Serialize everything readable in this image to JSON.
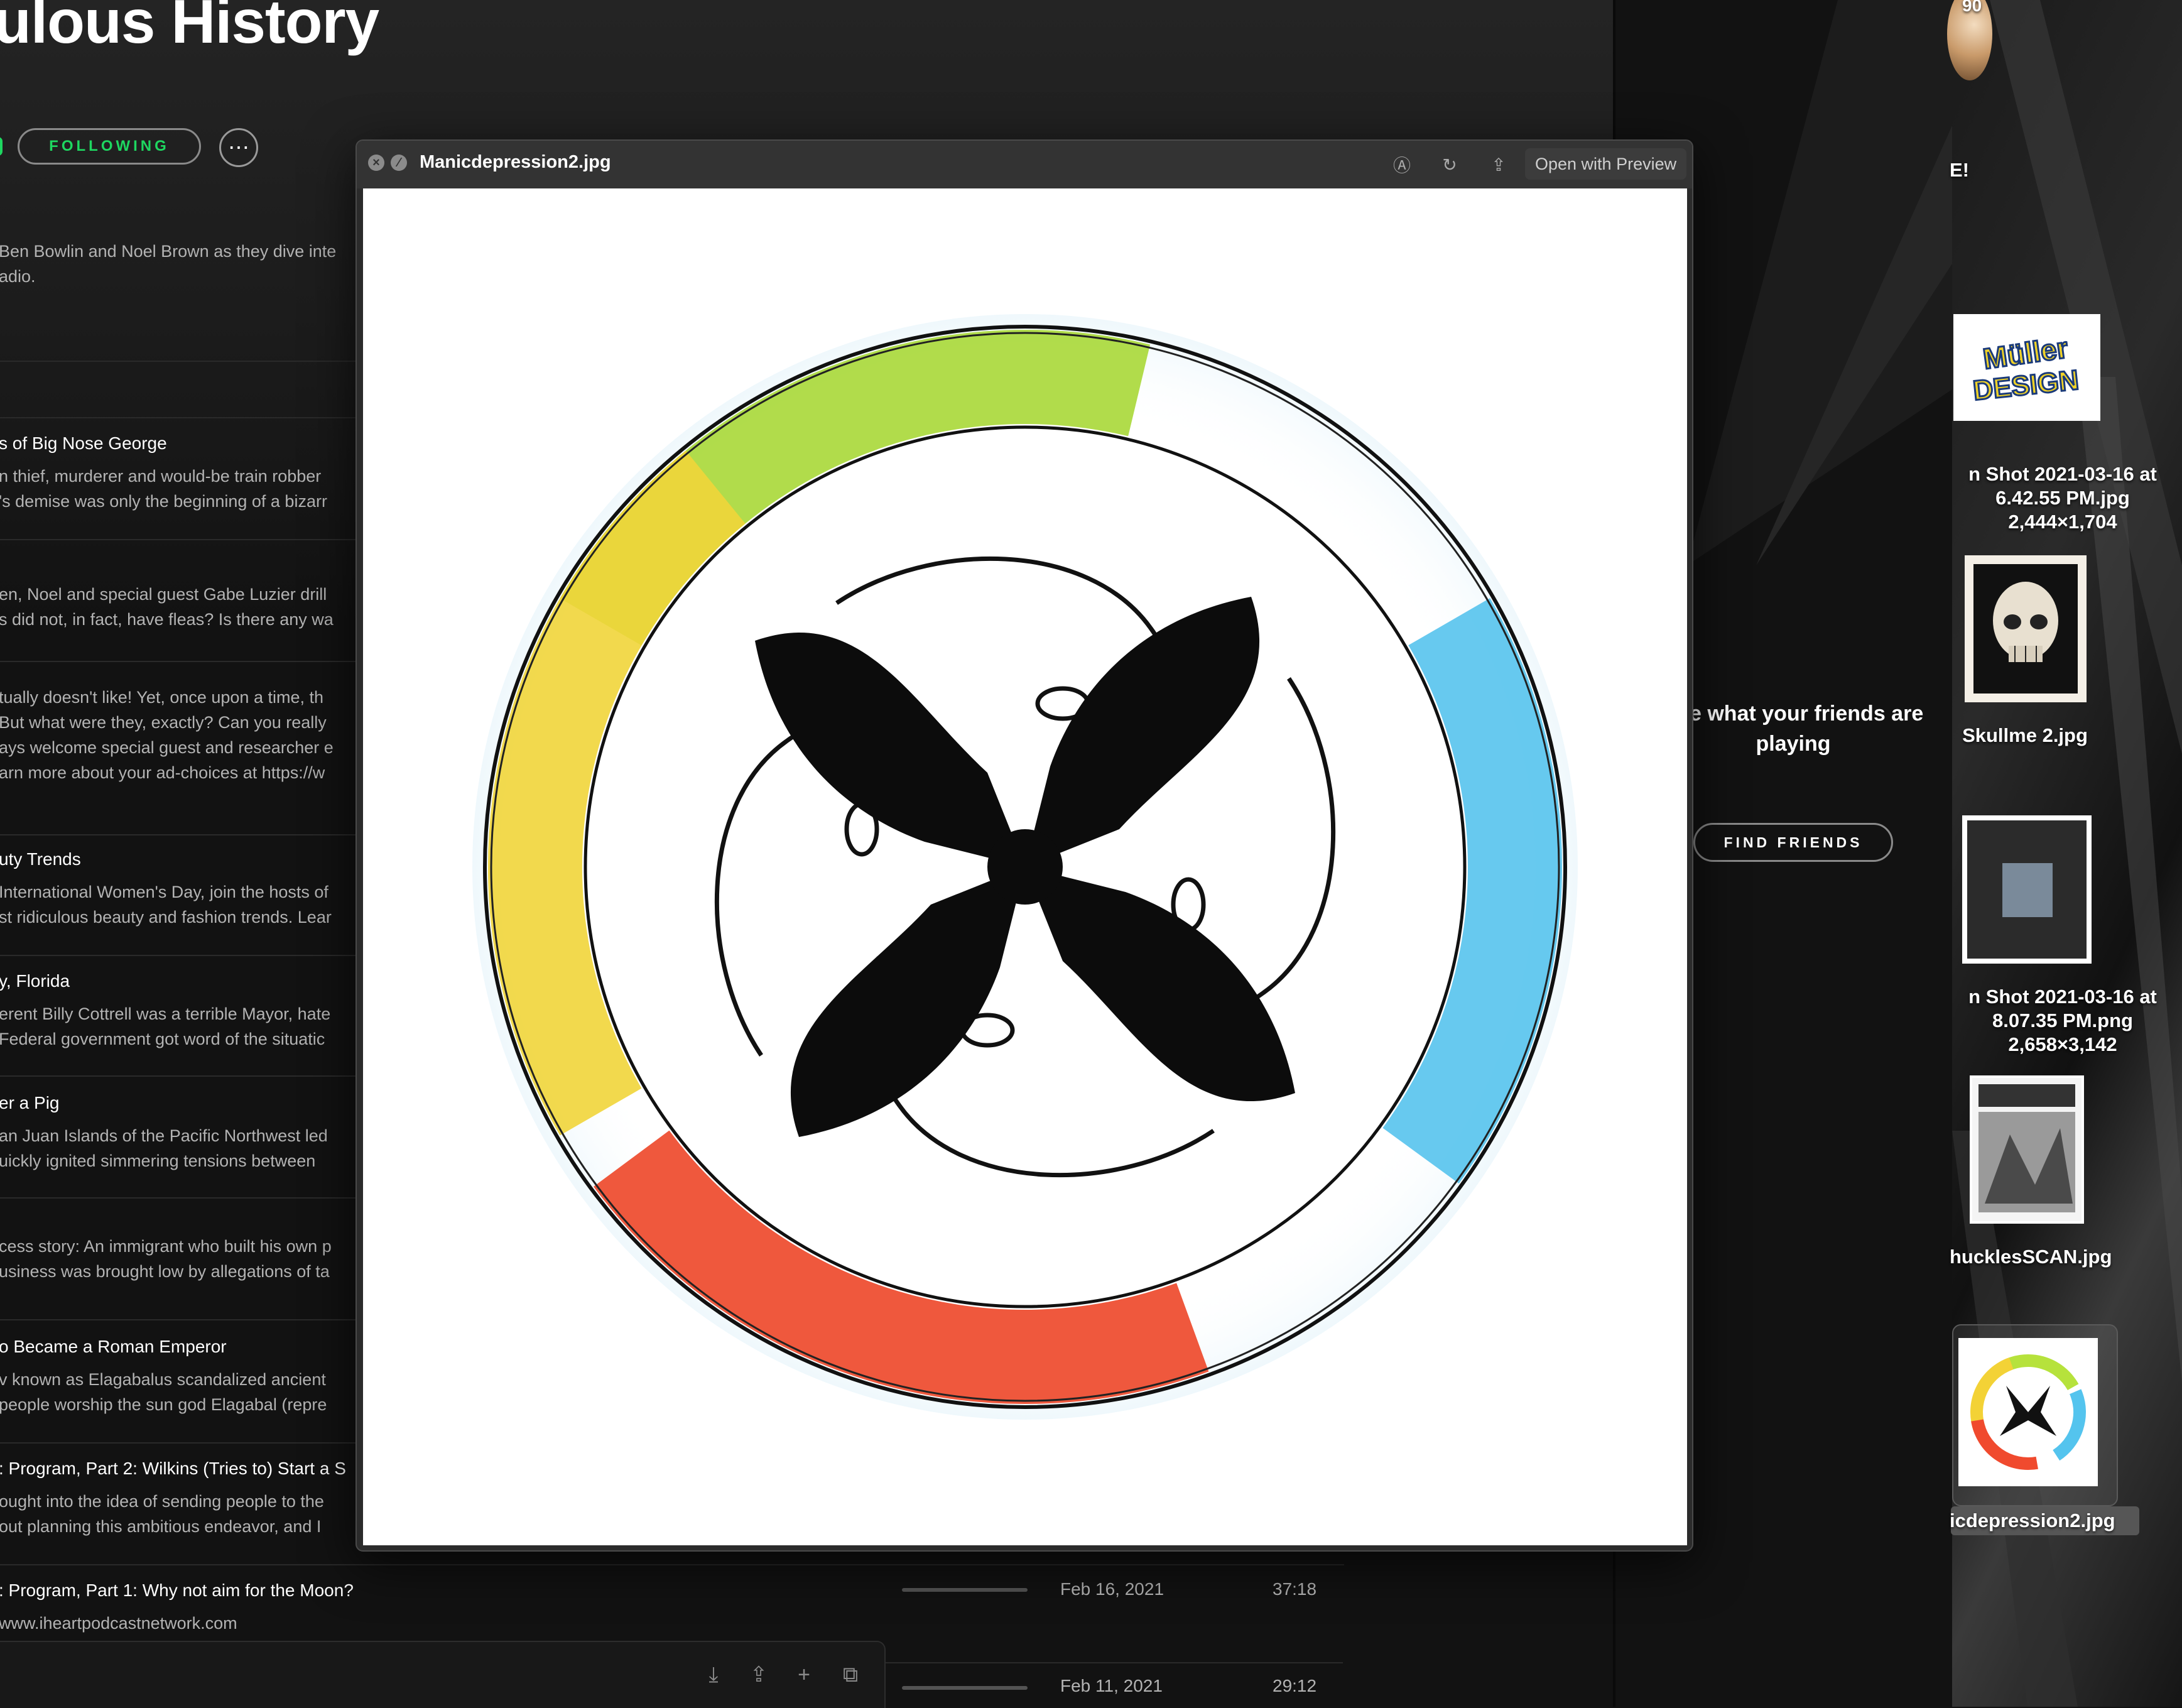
{
  "podcast": {
    "title": "ulous History",
    "follow_label": "FOLLOWING",
    "more_label": "⋯",
    "description": "Ben Bowlin and Noel Brown as they dive inte\nadio."
  },
  "episodes": [
    {
      "title": "s of Big Nose George",
      "desc": "n thief, murderer and would-be train robber\n's demise was only the beginning of a bizarr"
    },
    {
      "title": "",
      "desc": "en, Noel and special guest Gabe Luzier drill\ns did not, in fact, have fleas? Is there any wa"
    },
    {
      "title": "",
      "desc": "tually doesn't like! Yet, once upon a time, th\nBut what were they, exactly? Can you really\nays welcome special guest and researcher e\narn more about your ad-choices at https://w"
    },
    {
      "title": "uty Trends",
      "desc": "International Women's Day, join the hosts of\nst ridiculous beauty and fashion trends. Lear"
    },
    {
      "title": "y, Florida",
      "desc": "erent Billy Cottrell was a terrible Mayor, hate\nFederal government got word of the situatic"
    },
    {
      "title": "er a Pig",
      "desc": "an Juan Islands of the Pacific Northwest led\nuickly ignited simmering tensions between "
    },
    {
      "title": "",
      "desc": "cess story: An immigrant who built his own p\nusiness was brought low by allegations of ta"
    },
    {
      "title": "o Became a Roman Emperor",
      "desc": "v known as Elagabalus scandalized ancient\npeople worship the sun god Elagabal (repre"
    },
    {
      "title": ": Program, Part 2: Wilkins (Tries to) Start a S",
      "desc": "ought into the idea of sending people to the\nout planning this ambitious endeavor, and I"
    },
    {
      "title": ": Program, Part 1: Why not aim for the Moon?",
      "desc": "www.iheartpodcastnetwork.com"
    }
  ],
  "episode_meta": [
    {
      "date": "Feb 16, 2021",
      "duration": "37:18"
    },
    {
      "date": "Feb 11, 2021",
      "duration": "29:12"
    }
  ],
  "friends": {
    "text": "e what your friends are\nplaying",
    "button": "FIND FRIENDS"
  },
  "quicklook": {
    "filename": "Manicdepression2.jpg",
    "open_with": "Open with Preview",
    "close_glyph": "×",
    "fullscreen_glyph": "⁄"
  },
  "desktop": {
    "top_label": "90",
    "banner_label": "E!",
    "files": [
      {
        "label": "n Shot 2021-03-16 at\n6.42.55 PM.jpg\n2,444×1,704"
      },
      {
        "label": "Skullme 2.jpg"
      },
      {
        "label": "n Shot 2021-03-16 at\n8.07.35 PM.png\n2,658×3,142"
      },
      {
        "label": "hucklesSCAN.jpg"
      },
      {
        "label": "icdepression2.jpg"
      }
    ],
    "muller_logo_text": "Müller DESIGN"
  },
  "colors": {
    "spotify_green": "#1ed760",
    "background": "#121212",
    "window": "#2b2b2b"
  },
  "icons": {
    "download": "⤓",
    "share": "⇪",
    "add": "+",
    "copy": "⧉",
    "markup": "Ⓐ",
    "rotate": "↻",
    "ql_share": "⇪"
  }
}
